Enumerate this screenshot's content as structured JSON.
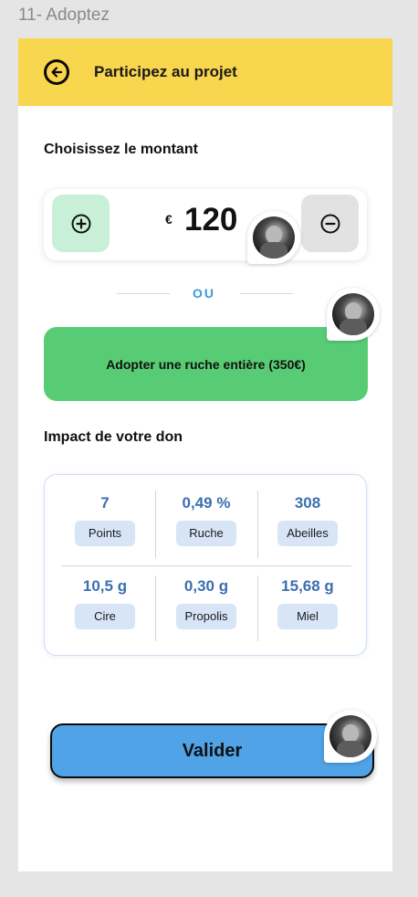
{
  "frame": {
    "label": "11- Adoptez"
  },
  "header": {
    "title": "Participez au projet",
    "back_icon": "arrow-left-circle-icon",
    "color": "#f8d64e"
  },
  "amount_section": {
    "title": "Choisissez le montant",
    "currency": "€",
    "amount": "120",
    "plus_icon": "plus-circle-icon",
    "minus_icon": "minus-circle-icon"
  },
  "separator": {
    "label": "OU"
  },
  "adopt_button": {
    "label": "Adopter une ruche entière (350€)",
    "color": "#58cc75"
  },
  "impact": {
    "title": "Impact de votre don",
    "stats": [
      {
        "value": "7",
        "label": "Points"
      },
      {
        "value": "0,49 %",
        "label": "Ruche"
      },
      {
        "value": "308",
        "label": "Abeilles"
      },
      {
        "value": "10,5 g",
        "label": "Cire"
      },
      {
        "value": "0,30 g",
        "label": "Propolis"
      },
      {
        "value": "15,68 g",
        "label": "Miel"
      }
    ]
  },
  "validate_button": {
    "label": "Valider",
    "color": "#4fa3e6"
  }
}
